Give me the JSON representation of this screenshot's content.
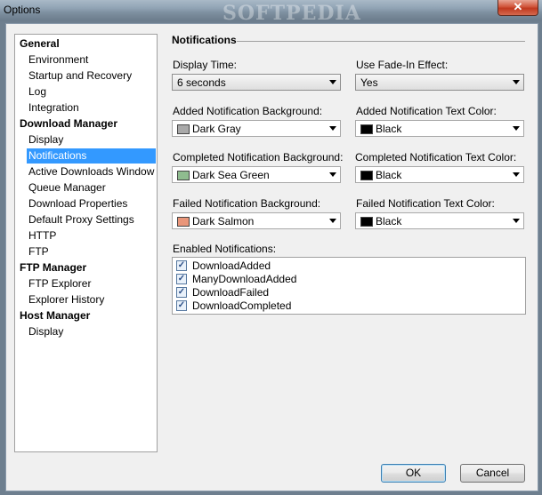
{
  "window": {
    "title": "Options",
    "close_glyph": "✕",
    "watermark": "SOFTPEDIA"
  },
  "tree": [
    {
      "label": "General",
      "kind": "group"
    },
    {
      "label": "Environment",
      "kind": "child"
    },
    {
      "label": "Startup and Recovery",
      "kind": "child"
    },
    {
      "label": "Log",
      "kind": "child"
    },
    {
      "label": "Integration",
      "kind": "child"
    },
    {
      "label": "Download Manager",
      "kind": "group"
    },
    {
      "label": "Display",
      "kind": "child"
    },
    {
      "label": "Notifications",
      "kind": "child",
      "selected": true
    },
    {
      "label": "Active Downloads Window",
      "kind": "child"
    },
    {
      "label": "Queue Manager",
      "kind": "child"
    },
    {
      "label": "Download Properties",
      "kind": "child"
    },
    {
      "label": "Default Proxy Settings",
      "kind": "child"
    },
    {
      "label": "HTTP",
      "kind": "child"
    },
    {
      "label": "FTP",
      "kind": "child"
    },
    {
      "label": "FTP Manager",
      "kind": "group"
    },
    {
      "label": "FTP Explorer",
      "kind": "child"
    },
    {
      "label": "Explorer History",
      "kind": "child"
    },
    {
      "label": "Host Manager",
      "kind": "group"
    },
    {
      "label": "Display",
      "kind": "child"
    }
  ],
  "panel": {
    "title": "Notifications",
    "display_time": {
      "label": "Display Time:",
      "value": "6 seconds"
    },
    "fade_in": {
      "label": "Use Fade-In Effect:",
      "value": "Yes"
    },
    "added_bg": {
      "label": "Added Notification Background:",
      "value": "Dark Gray",
      "color": "#a9a9a9"
    },
    "added_text": {
      "label": "Added Notification Text Color:",
      "value": "Black",
      "color": "#000000"
    },
    "completed_bg": {
      "label": "Completed Notification Background:",
      "value": "Dark Sea Green",
      "color": "#8fbc8f"
    },
    "completed_text": {
      "label": "Completed Notification Text Color:",
      "value": "Black",
      "color": "#000000"
    },
    "failed_bg": {
      "label": "Failed Notification Background:",
      "value": "Dark Salmon",
      "color": "#e9967a"
    },
    "failed_text": {
      "label": "Failed Notification Text Color:",
      "value": "Black",
      "color": "#000000"
    },
    "enabled_label": "Enabled Notifications:",
    "enabled": [
      {
        "label": "DownloadAdded",
        "checked": true
      },
      {
        "label": "ManyDownloadAdded",
        "checked": true
      },
      {
        "label": "DownloadFailed",
        "checked": true
      },
      {
        "label": "DownloadCompleted",
        "checked": true
      }
    ],
    "check_glyph": "✓"
  },
  "buttons": {
    "ok": "OK",
    "cancel": "Cancel"
  }
}
